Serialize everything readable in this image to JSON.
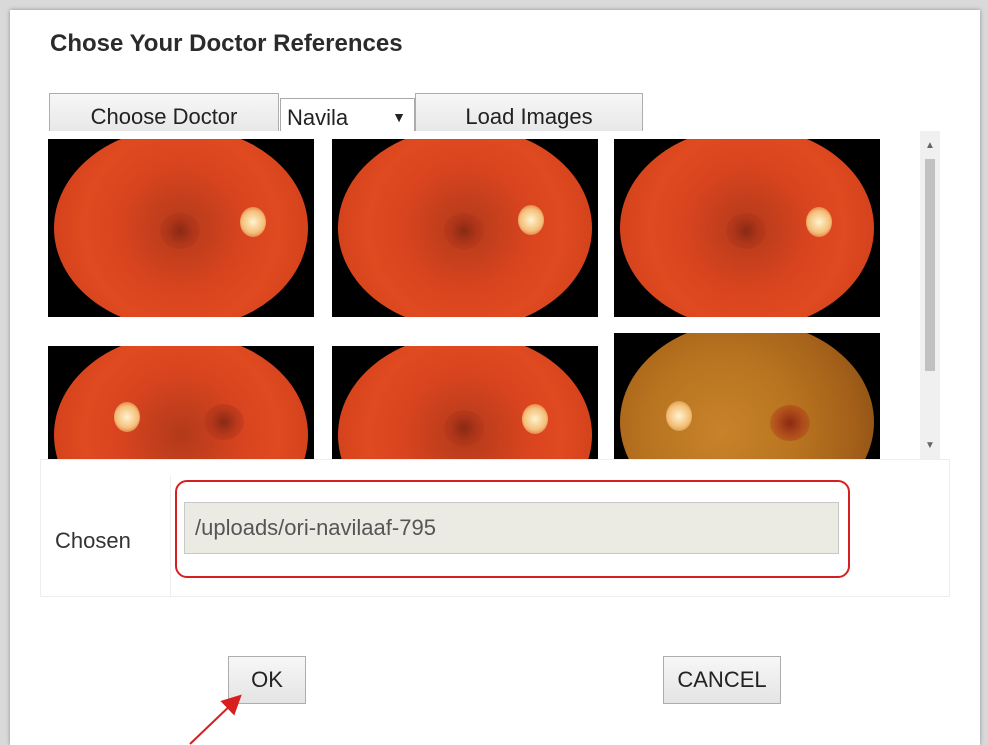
{
  "dialog": {
    "title": "Chose Your Doctor References"
  },
  "toolbar": {
    "choose_doctor_label": "Choose Doctor",
    "doctor_select_value": "Navila",
    "load_images_label": "Load Images"
  },
  "gallery": {
    "images": [
      {
        "name": "fundus-image-1"
      },
      {
        "name": "fundus-image-2"
      },
      {
        "name": "fundus-image-3"
      },
      {
        "name": "fundus-image-4"
      },
      {
        "name": "fundus-image-5"
      },
      {
        "name": "fundus-image-6"
      }
    ]
  },
  "chosen": {
    "label": "Chosen",
    "value": "/uploads/ori-navilaaf-795"
  },
  "actions": {
    "ok_label": "OK",
    "cancel_label": "CANCEL"
  },
  "annotation": {
    "highlight_color": "#d81f1f"
  }
}
